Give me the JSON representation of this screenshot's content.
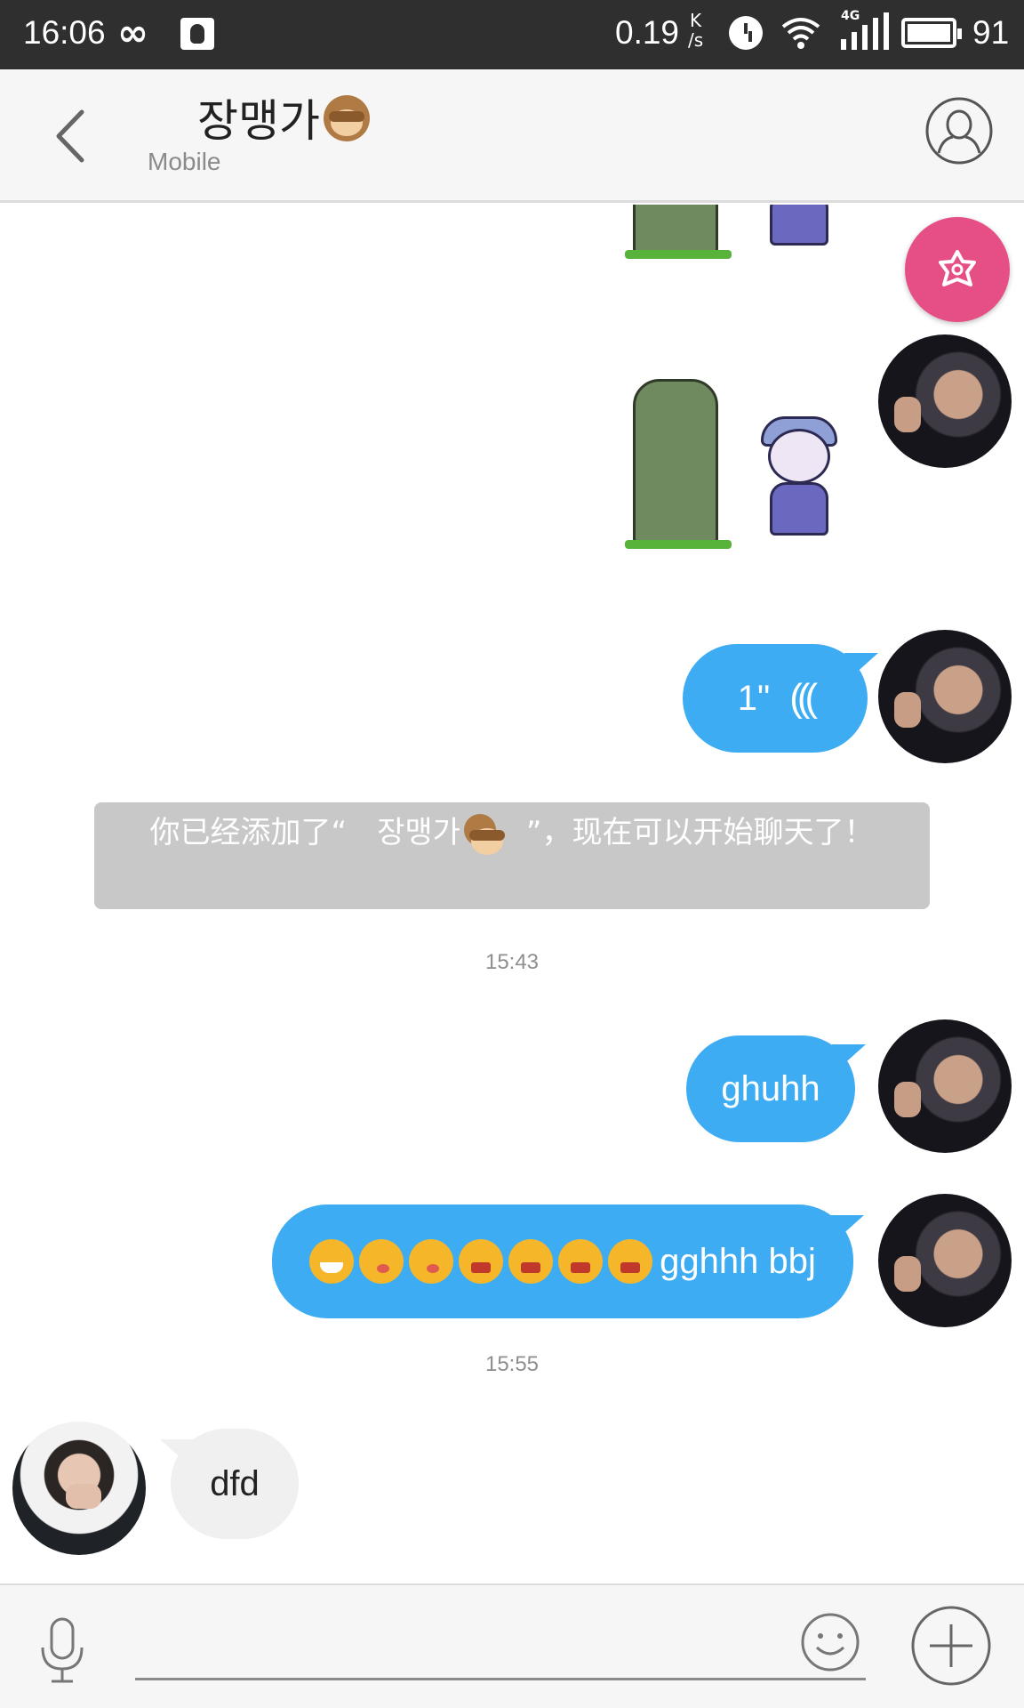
{
  "status_bar": {
    "time": "16:06",
    "infinity_glyph": "∞",
    "speed_value": "0.19",
    "speed_unit_top": "K",
    "speed_unit_bottom": "/s",
    "network_label": "4G",
    "battery_level": "91",
    "icons": [
      "infinity-icon",
      "qq-icon",
      "alarm-icon",
      "wifi-icon",
      "signal-icon",
      "battery-icon"
    ]
  },
  "header": {
    "title": "장맹가",
    "title_emoji": "see-no-evil-monkey-icon",
    "subtitle": "Mobile",
    "back_icon": "chevron-left-icon",
    "profile_icon": "person-icon"
  },
  "chat": {
    "fab_icon": "flower-icon",
    "fab_color": "#e64f86",
    "outgoing_bubble_color": "#3eacf3",
    "messages": [
      {
        "type": "sticker",
        "direction": "out",
        "description_icon": "tree-and-mage-sticker"
      },
      {
        "type": "sticker",
        "direction": "out",
        "description_icon": "tree-and-mage-sticker"
      },
      {
        "type": "voice",
        "direction": "out",
        "duration": "1\"",
        "waves": "((( "
      },
      {
        "type": "system",
        "text_before": "你已经添加了“　",
        "name": "장맹가",
        "text_after": "　”，现在可以开始聊天了！"
      },
      {
        "type": "timestamp",
        "text": "15:43"
      },
      {
        "type": "text",
        "direction": "out",
        "text": "ghuhh"
      },
      {
        "type": "text",
        "direction": "out",
        "emojis": [
          "grimace",
          "wink",
          "wink",
          "angry",
          "angry",
          "angry",
          "angry"
        ],
        "text": "gghhh bbj"
      },
      {
        "type": "timestamp",
        "text": "15:55"
      },
      {
        "type": "text",
        "direction": "in",
        "text": "dfd"
      }
    ]
  },
  "input_bar": {
    "value": "",
    "placeholder": "",
    "mic_icon": "microphone-icon",
    "emoji_icon": "smiley-icon",
    "plus_icon": "plus-icon"
  }
}
